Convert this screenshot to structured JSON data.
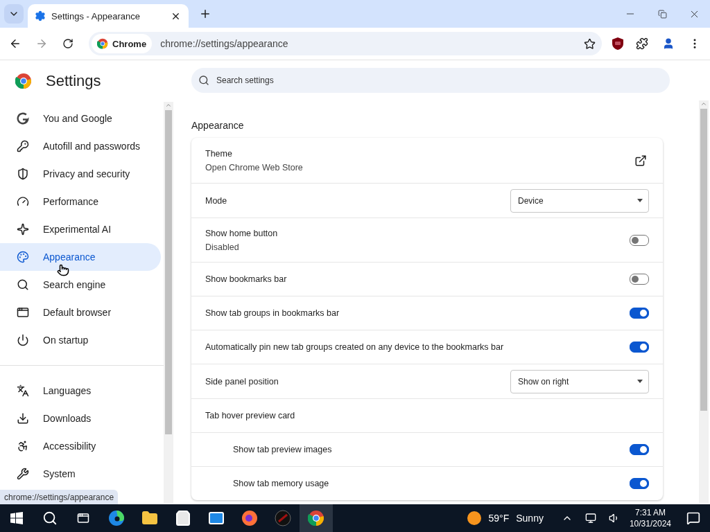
{
  "browser": {
    "tab": {
      "title": "Settings - Appearance"
    },
    "chip": "Chrome",
    "url": "chrome://settings/appearance",
    "status_url": "chrome://settings/appearance"
  },
  "settings": {
    "title": "Settings",
    "search": {
      "placeholder": "Search settings"
    }
  },
  "sidebar": {
    "items": [
      {
        "label": "You and Google",
        "selected": false
      },
      {
        "label": "Autofill and passwords",
        "selected": false
      },
      {
        "label": "Privacy and security",
        "selected": false
      },
      {
        "label": "Performance",
        "selected": false
      },
      {
        "label": "Experimental AI",
        "selected": false
      },
      {
        "label": "Appearance",
        "selected": true
      },
      {
        "label": "Search engine",
        "selected": false
      },
      {
        "label": "Default browser",
        "selected": false
      },
      {
        "label": "On startup",
        "selected": false
      },
      {
        "label": "Languages",
        "selected": false
      },
      {
        "label": "Downloads",
        "selected": false
      },
      {
        "label": "Accessibility",
        "selected": false
      },
      {
        "label": "System",
        "selected": false
      }
    ]
  },
  "section": {
    "title": "Appearance",
    "rows": [
      {
        "kind": "link",
        "label": "Theme",
        "sublabel": "Open Chrome Web Store"
      },
      {
        "kind": "select",
        "label": "Mode",
        "value": "Device"
      },
      {
        "kind": "toggle",
        "label": "Show home button",
        "sublabel": "Disabled",
        "on": false
      },
      {
        "kind": "toggle",
        "label": "Show bookmarks bar",
        "on": false
      },
      {
        "kind": "toggle",
        "label": "Show tab groups in bookmarks bar",
        "on": true
      },
      {
        "kind": "toggle",
        "label": "Automatically pin new tab groups created on any device to the bookmarks bar",
        "on": true
      },
      {
        "kind": "select",
        "label": "Side panel position",
        "value": "Show on right"
      },
      {
        "kind": "heading",
        "label": "Tab hover preview card",
        "children": [
          {
            "kind": "toggle",
            "label": "Show tab preview images",
            "on": true
          },
          {
            "kind": "toggle",
            "label": "Show tab memory usage",
            "on": true
          }
        ]
      }
    ]
  },
  "taskbar": {
    "weather": {
      "temp": "59°F",
      "condition": "Sunny"
    },
    "time": "7:31 AM",
    "date": "10/31/2024"
  }
}
